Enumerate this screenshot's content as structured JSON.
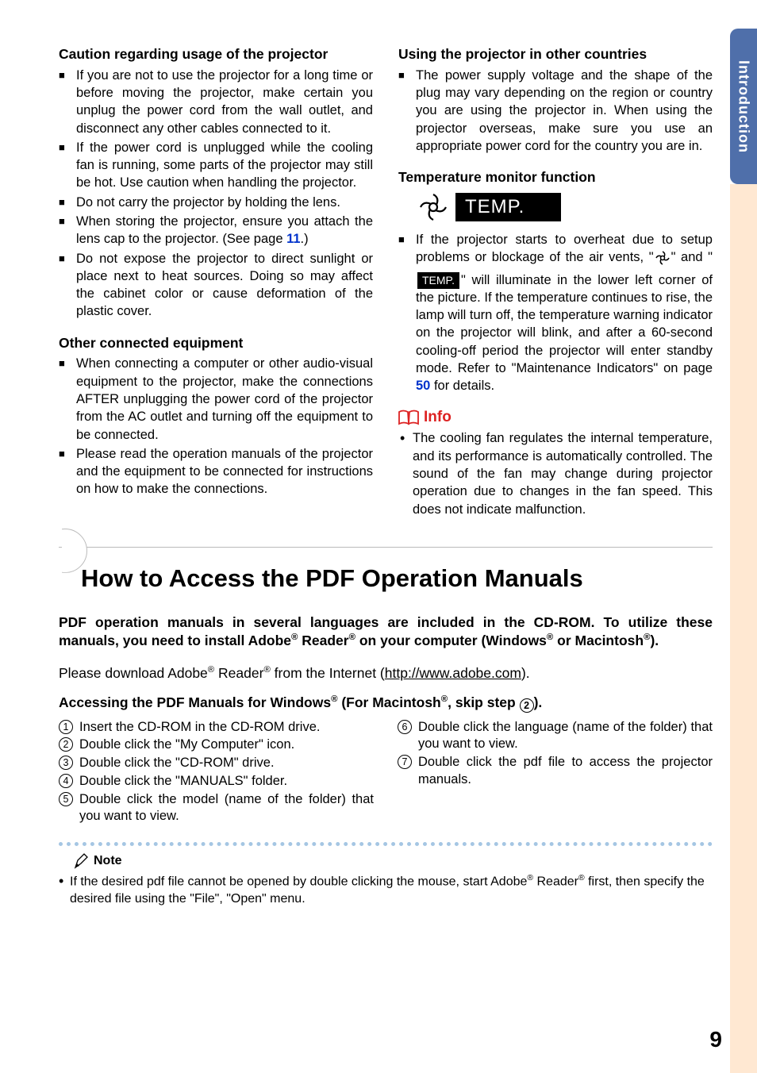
{
  "sideTab": "Introduction",
  "pageNumber": "9",
  "col1": {
    "h1": "Caution regarding usage of the projector",
    "b1": "If you are not to use the projector for a long time or before moving the projector, make certain you unplug the power cord from the wall outlet, and disconnect any other cables connected to it.",
    "b2": "If the power cord is unplugged while the cooling fan is running, some parts of the projector may still be hot. Use caution when handling the projector.",
    "b3": "Do not carry the projector by holding the lens.",
    "b4a": "When storing the projector, ensure you attach the lens cap to the projector. (See page ",
    "b4link": "11",
    "b4b": ".)",
    "b5": "Do not expose the projector to direct sunlight or place next to heat sources. Doing so may affect the cabinet color or cause deformation of the plastic cover.",
    "h2": "Other connected equipment",
    "c1": "When connecting a computer or other audio-visual equipment to the projector, make the connections AFTER unplugging the power cord of the projector from the AC outlet and turning off the equipment to be connected.",
    "c2": "Please read the operation manuals of the projector and the equipment to be connected for instructions on how to make the connections."
  },
  "col2": {
    "h1": "Using the projector in other countries",
    "b1": "The power supply voltage and the shape of the plug may vary depending on the region or country you are using the projector in. When using the projector overseas, make sure you use an appropriate power cord for the country you are in.",
    "h2": "Temperature monitor function",
    "tempWord": "TEMP.",
    "t1a": "If the projector starts to overheat due to setup problems or blockage of the air vents, \"",
    "t1b": "\" and \"",
    "t1c": "\" will illuminate in the lower left corner of the picture. If the temperature continues to rise, the lamp will turn off, the temperature warning indicator on the projector will blink, and after a 60-second cooling-off period the projector will enter standby mode. Refer to \"Maintenance Indicators\" on page ",
    "t1link": "50",
    "t1d": " for details.",
    "infoLabel": "Info",
    "info1": "The cooling fan regulates the internal temperature, and its performance is automatically controlled. The sound of the fan may change during projector operation due to changes in the fan speed. This does not indicate malfunction."
  },
  "lower": {
    "title": "How to Access the PDF Operation Manuals",
    "intro1a": "PDF operation manuals in several languages are included in the CD-ROM. To utilize these manuals, you need to install Adobe",
    "intro1b": " Reader",
    "intro1c": " on your computer (Windows",
    "intro1d": " or Macintosh",
    "intro1e": ").",
    "intro2a": "Please download Adobe",
    "intro2b": " Reader",
    "intro2c": " from the Internet (",
    "intro2url": "http://www.adobe.com",
    "intro2d": ").",
    "accessHeadA": "Accessing the PDF Manuals for Windows",
    "accessHeadB": " (For Macintosh",
    "accessHeadC": ", skip step ",
    "accessHeadD": ").",
    "s1": "Insert the CD-ROM in the CD-ROM drive.",
    "s2": "Double click the \"My Computer\" icon.",
    "s3": "Double click the \"CD-ROM\" drive.",
    "s4": "Double click the \"MANUALS\" folder.",
    "s5": "Double click the model (name of the folder) that you want to view.",
    "s6": "Double click the language (name of the folder) that you want to view.",
    "s7": "Double click the pdf file to access the projector manuals.",
    "noteLabel": "Note",
    "noteBodyA": "If the desired pdf file cannot be opened by double clicking the mouse, start Adobe",
    "noteBodyB": " Reader",
    "noteBodyC": " first, then specify the desired file using the \"File\", \"Open\" menu."
  }
}
